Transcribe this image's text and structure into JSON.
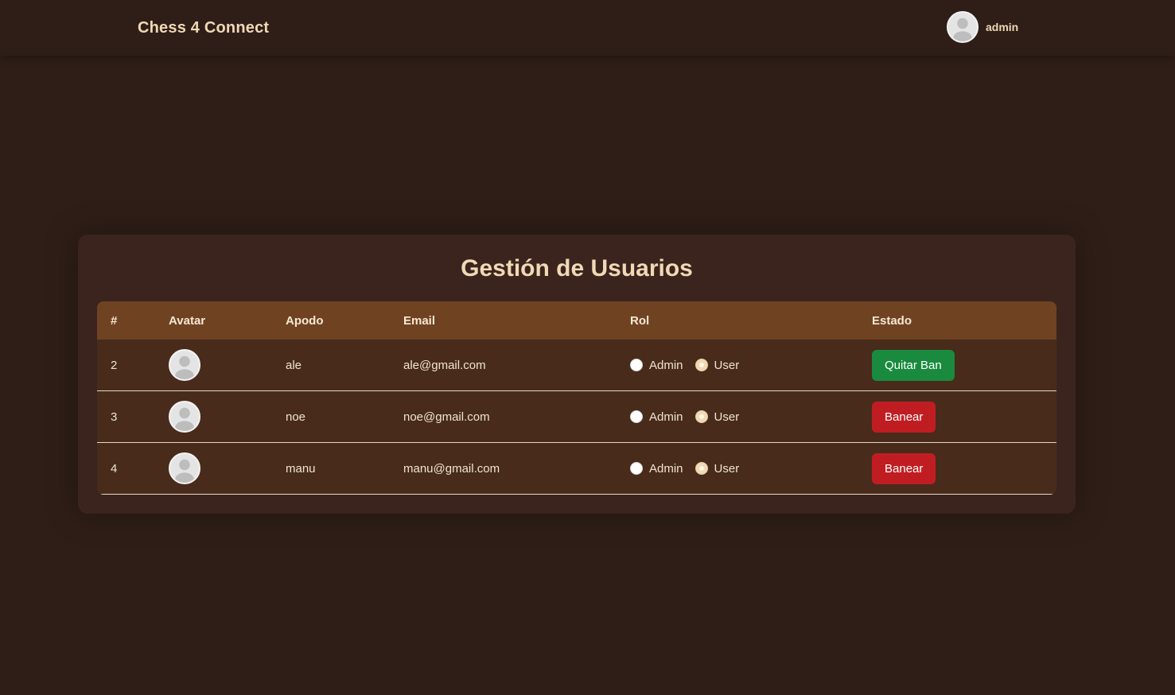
{
  "nav": {
    "brand": "Chess 4 Connect",
    "user": {
      "name": "admin",
      "avatar_icon": "user-avatar-icon"
    }
  },
  "panel": {
    "title": "Gestión de Usuarios",
    "columns": [
      "#",
      "Avatar",
      "Apodo",
      "Email",
      "Rol",
      "Estado"
    ],
    "rows": [
      {
        "id": "2",
        "apodo": "ale",
        "email": "ale@gmail.com",
        "rol_options": [
          "Admin",
          "User"
        ],
        "rol_selected": "User",
        "accion": "Quitar Ban",
        "accion_color": "#198a3e"
      },
      {
        "id": "3",
        "apodo": "noe",
        "email": "noe@gmail.com",
        "rol_options": [
          "Admin",
          "User"
        ],
        "rol_selected": "User",
        "accion": "Banear",
        "accion_color": "#c01d22"
      },
      {
        "id": "4",
        "apodo": "manu",
        "email": "manu@gmail.com",
        "rol_options": [
          "Admin",
          "User"
        ],
        "rol_selected": "User",
        "accion": "Banear",
        "accion_color": "#c01d22"
      }
    ]
  },
  "colors": {
    "background": "#2f1e17",
    "card": "#3b241d",
    "header": "#6f4322",
    "row": "#482b1a",
    "accent_text": "#f0d9b5"
  }
}
